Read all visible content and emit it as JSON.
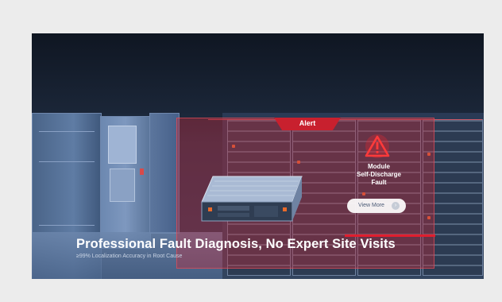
{
  "banner": {
    "alert_label": "Alert",
    "fault_lines": [
      "Module",
      "Self-Discharge",
      "Fault"
    ],
    "view_more_label": "View More",
    "chevron": "›",
    "headline": "Professional Fault Diagnosis, No Expert Site Visits",
    "subline": "≥99% Localization Accuracy in Root Cause",
    "icons": [
      "warning-triangle-icon",
      "chevron-right-icon"
    ],
    "colors": {
      "alert_red": "#c8202e",
      "overlay_red": "rgba(200,40,55,0.38)",
      "accent_bar": "#e01e2e",
      "background": "#ececec",
      "text": "#ffffff"
    }
  }
}
